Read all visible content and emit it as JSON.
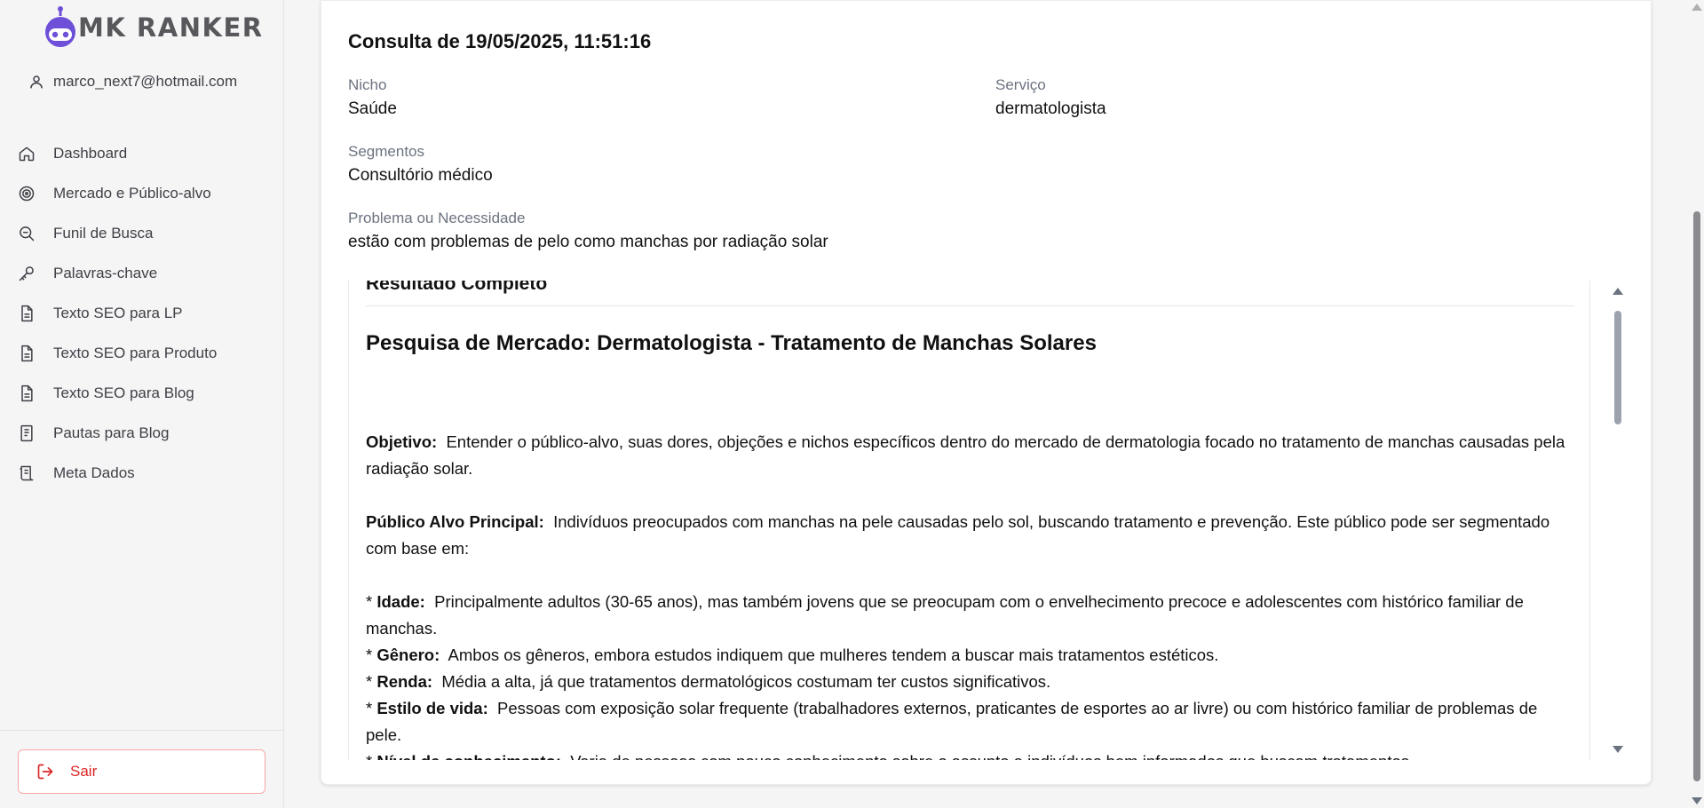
{
  "app": {
    "name": "MK RANKER",
    "user_email": "marco_next7@hotmail.com"
  },
  "sidebar": {
    "items": [
      {
        "label": "Dashboard",
        "icon": "home-icon"
      },
      {
        "label": "Mercado e Público-alvo",
        "icon": "target-icon"
      },
      {
        "label": "Funil de Busca",
        "icon": "search-zoom-icon"
      },
      {
        "label": "Palavras-chave",
        "icon": "key-icon"
      },
      {
        "label": "Texto SEO para LP",
        "icon": "document-icon"
      },
      {
        "label": "Texto SEO para Produto",
        "icon": "document-icon"
      },
      {
        "label": "Texto SEO para Blog",
        "icon": "document-icon"
      },
      {
        "label": "Pautas para Blog",
        "icon": "notebook-icon"
      },
      {
        "label": "Meta Dados",
        "icon": "scroll-icon"
      }
    ],
    "logout_label": "Sair"
  },
  "consulta": {
    "title": "Consulta de 19/05/2025, 11:51:16",
    "nicho_label": "Nicho",
    "nicho_value": "Saúde",
    "servico_label": "Serviço",
    "servico_value": "dermatologista",
    "segmentos_label": "Segmentos",
    "segmentos_value": "Consultório médico",
    "problema_label": "Problema ou Necessidade",
    "problema_value": "estão com problemas de pelo como manchas por radiação solar"
  },
  "result": {
    "heading": "Resultado Completo",
    "doc_title": "Pesquisa de Mercado: Dermatologista - Tratamento de Manchas Solares",
    "objetivo_label": "Objetivo:",
    "objetivo_text": "Entender o público-alvo, suas dores, objeções e  nichos específicos dentro do mercado de dermatologia focado no tratamento de manchas causadas pela radiação solar.",
    "publico_label": "Público Alvo Principal:",
    "publico_text": "Indivíduos preocupados com manchas na pele causadas pelo sol, buscando tratamento e prevenção.  Este público pode ser segmentado com base em:",
    "bullets": [
      {
        "label": "Idade:",
        "text": "Principalmente adultos (30-65 anos), mas também jovens que se preocupam com o envelhecimento precoce e adolescentes com histórico familiar de manchas."
      },
      {
        "label": "Gênero:",
        "text": "Ambos os gêneros, embora estudos indiquem que mulheres tendem a buscar mais tratamentos estéticos."
      },
      {
        "label": "Renda:",
        "text": "Média a alta, já que tratamentos dermatológicos costumam ter custos significativos."
      },
      {
        "label": "Estilo de vida:",
        "text": "Pessoas com exposição solar frequente (trabalhadores externos, praticantes de esportes ao ar livre) ou com histórico familiar de problemas de pele."
      },
      {
        "label": "Nível de conhecimento:",
        "text": "Varia de pessoas com pouco conhecimento sobre o assunto a indivíduos bem informados que buscam tratamentos"
      }
    ],
    "bullet_marker": "*"
  },
  "colors": {
    "logo_purple": "#6d4fd8",
    "logout_red": "#dc2626"
  }
}
